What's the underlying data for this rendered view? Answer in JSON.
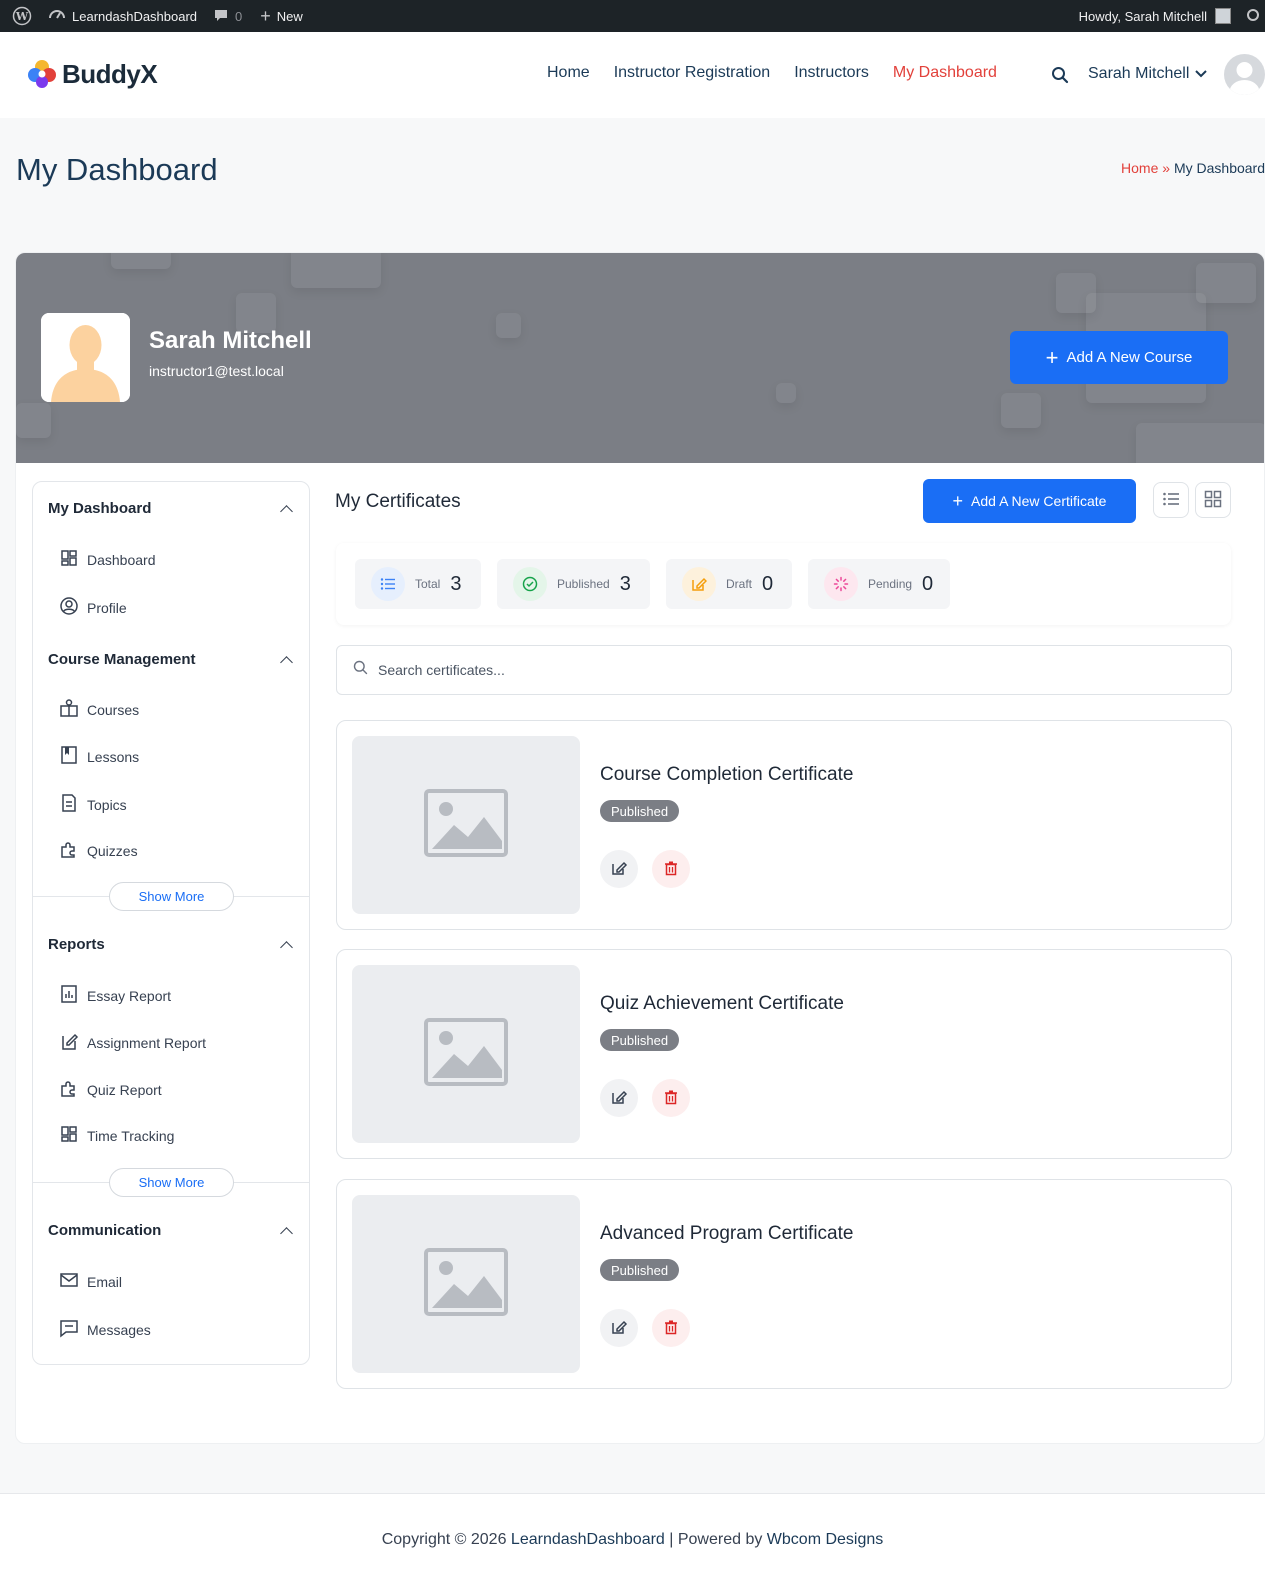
{
  "adminbar": {
    "site_name": "LearndashDashboard",
    "comments_count": "0",
    "new_label": "New",
    "howdy": "Howdy, Sarah Mitchell"
  },
  "header": {
    "logo_text": "BuddyX",
    "nav": [
      {
        "label": "Home"
      },
      {
        "label": "Instructor Registration"
      },
      {
        "label": "Instructors"
      },
      {
        "label": "My Dashboard",
        "active": true
      }
    ],
    "user_name": "Sarah Mitchell"
  },
  "title_band": {
    "title": "My Dashboard",
    "breadcrumb_home": "Home",
    "breadcrumb_sep": "»",
    "breadcrumb_current": "My Dashboard"
  },
  "profile": {
    "name": "Sarah Mitchell",
    "email": "instructor1@test.local",
    "add_course_label": "Add A New Course"
  },
  "sidebar": {
    "sections": [
      {
        "title": "My Dashboard",
        "items": [
          "Dashboard",
          "Profile"
        ]
      },
      {
        "title": "Course Management",
        "items": [
          "Courses",
          "Lessons",
          "Topics",
          "Quizzes"
        ],
        "show_more": "Show More"
      },
      {
        "title": "Reports",
        "items": [
          "Essay Report",
          "Assignment Report",
          "Quiz Report",
          "Time Tracking"
        ],
        "show_more": "Show More"
      },
      {
        "title": "Communication",
        "items": [
          "Email",
          "Messages"
        ]
      }
    ]
  },
  "main": {
    "title": "My Certificates",
    "add_certificate_label": "Add A New Certificate",
    "stats": [
      {
        "label": "Total",
        "value": "3",
        "color": "#3b82f6"
      },
      {
        "label": "Published",
        "value": "3",
        "color": "#16a34a"
      },
      {
        "label": "Draft",
        "value": "0",
        "color": "#f59e0b"
      },
      {
        "label": "Pending",
        "value": "0",
        "color": "#ec4899"
      }
    ],
    "search_placeholder": "Search certificates...",
    "certificates": [
      {
        "title": "Course Completion Certificate",
        "status": "Published"
      },
      {
        "title": "Quiz Achievement Certificate",
        "status": "Published"
      },
      {
        "title": "Advanced Program Certificate",
        "status": "Published"
      }
    ]
  },
  "footer": {
    "prefix": "Copyright © 2026 ",
    "site_link": "LearndashDashboard",
    "middle": " | Powered by ",
    "powered_link": "Wbcom Designs"
  },
  "colors": {
    "accent": "#1a6ef5",
    "active_nav": "#e2413b",
    "badge": "#7b7e85"
  }
}
